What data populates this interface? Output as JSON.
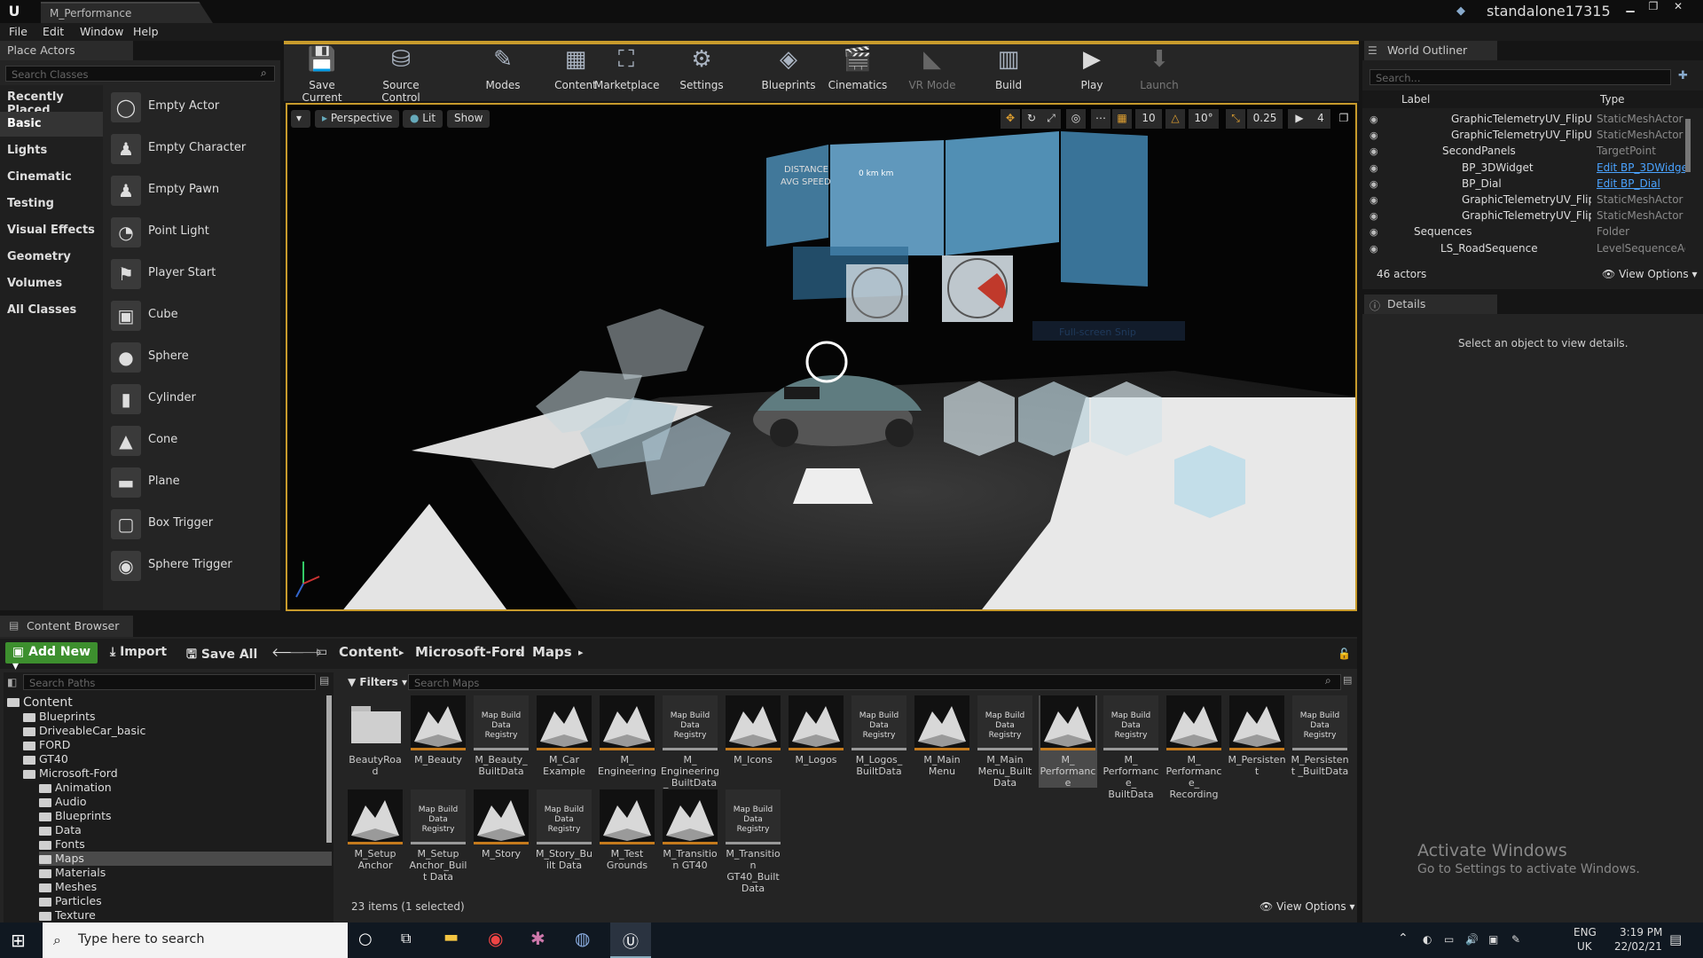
{
  "window": {
    "tab_title": "M_Performance",
    "project": "standalone17315"
  },
  "menu": [
    "File",
    "Edit",
    "Window",
    "Help"
  ],
  "place_actors": {
    "tab": "Place Actors",
    "search_placeholder": "Search Classes",
    "categories": [
      "Recently Placed",
      "Basic",
      "Lights",
      "Cinematic",
      "Testing",
      "Visual Effects",
      "Geometry",
      "Volumes",
      "All Classes"
    ],
    "selected_category": "Basic",
    "actors": [
      "Empty Actor",
      "Empty Character",
      "Empty Pawn",
      "Point Light",
      "Player Start",
      "Cube",
      "Sphere",
      "Cylinder",
      "Cone",
      "Plane",
      "Box Trigger",
      "Sphere Trigger"
    ]
  },
  "toolbar": {
    "buttons": [
      "Save Current",
      "Source Control",
      "Modes",
      "Content",
      "Marketplace",
      "Settings",
      "Blueprints",
      "Cinematics",
      "VR Mode",
      "Build",
      "Play",
      "Launch"
    ]
  },
  "viewport": {
    "perspective": "Perspective",
    "lit": "Lit",
    "show": "Show",
    "grid_snap": "10",
    "rot_snap": "10°",
    "scale_snap": "0.25",
    "cam_speed": "4",
    "scene_text": {
      "distance": "DISTANCE",
      "avg_speed": "AVG SPEED",
      "panel_value": "0 km km",
      "fullscreen": "Full-screen Snip"
    }
  },
  "world_outliner": {
    "tab": "World Outliner",
    "search_placeholder": "Search...",
    "col_label": "Label",
    "col_type": "Type",
    "rows": [
      {
        "label": "GraphicTelemetryUV_FlipUV_T",
        "type": "StaticMeshActor",
        "link": false
      },
      {
        "label": "GraphicTelemetryUV_FlipUV_T",
        "type": "StaticMeshActor",
        "link": false
      },
      {
        "label": "SecondPanels",
        "type": "TargetPoint",
        "link": false
      },
      {
        "label": "BP_3DWidget",
        "type": "Edit BP_3DWidge",
        "link": true
      },
      {
        "label": "BP_Dial",
        "type": "Edit BP_Dial",
        "link": true
      },
      {
        "label": "GraphicTelemetryUV_FlipUV",
        "type": "StaticMeshActor",
        "link": false
      },
      {
        "label": "GraphicTelemetryUV_FlipUV",
        "type": "StaticMeshActor",
        "link": false
      },
      {
        "label": "Sequences",
        "type": "Folder",
        "link": false
      },
      {
        "label": "LS_RoadSequence",
        "type": "LevelSequenceAct",
        "link": false
      }
    ],
    "actor_count": "46 actors",
    "view_options": "View Options"
  },
  "details": {
    "tab": "Details",
    "message": "Select an object to view details."
  },
  "content_browser": {
    "tab": "Content Browser",
    "add_new": "Add New",
    "import": "Import",
    "save_all": "Save All",
    "breadcrumbs": [
      "Content",
      "Microsoft-Ford",
      "Maps"
    ],
    "search_paths_placeholder": "Search Paths",
    "filters": "Filters",
    "search_maps_placeholder": "Search Maps",
    "tree": [
      {
        "label": "Content",
        "depth": 0
      },
      {
        "label": "Blueprints",
        "depth": 1
      },
      {
        "label": "DriveableCar_basic",
        "depth": 1
      },
      {
        "label": "FORD",
        "depth": 1
      },
      {
        "label": "GT40",
        "depth": 1
      },
      {
        "label": "Microsoft-Ford",
        "depth": 1
      },
      {
        "label": "Animation",
        "depth": 2
      },
      {
        "label": "Audio",
        "depth": 2
      },
      {
        "label": "Blueprints",
        "depth": 2
      },
      {
        "label": "Data",
        "depth": 2
      },
      {
        "label": "Fonts",
        "depth": 2
      },
      {
        "label": "Maps",
        "depth": 2
      },
      {
        "label": "Materials",
        "depth": 2
      },
      {
        "label": "Meshes",
        "depth": 2
      },
      {
        "label": "Particles",
        "depth": 2
      },
      {
        "label": "Texture",
        "depth": 2
      }
    ],
    "registry_text": "Map Build Data Registry",
    "assets": [
      {
        "label": "BeautyRoad",
        "kind": "folder"
      },
      {
        "label": "M_Beauty",
        "kind": "map"
      },
      {
        "label": "M_Beauty_ BuiltData",
        "kind": "reg"
      },
      {
        "label": "M_Car Example",
        "kind": "map"
      },
      {
        "label": "M_ Engineering",
        "kind": "map"
      },
      {
        "label": "M_ Engineering_ BuiltData",
        "kind": "reg"
      },
      {
        "label": "M_Icons",
        "kind": "map"
      },
      {
        "label": "M_Logos",
        "kind": "map"
      },
      {
        "label": "M_Logos_ BuiltData",
        "kind": "reg"
      },
      {
        "label": "M_Main Menu",
        "kind": "map"
      },
      {
        "label": "M_Main Menu_Built Data",
        "kind": "reg"
      },
      {
        "label": "M_ Performance",
        "kind": "map",
        "selected": true
      },
      {
        "label": "M_ Performance_ BuiltData",
        "kind": "reg"
      },
      {
        "label": "M_ Performance_ Recording",
        "kind": "map"
      },
      {
        "label": "M_Persistent",
        "kind": "map"
      },
      {
        "label": "M_Persistent _BuiltData",
        "kind": "reg"
      },
      {
        "label": "M_Setup Anchor",
        "kind": "map"
      },
      {
        "label": "M_Setup Anchor_Built Data",
        "kind": "reg"
      },
      {
        "label": "M_Story",
        "kind": "map"
      },
      {
        "label": "M_Story_Built Data",
        "kind": "reg"
      },
      {
        "label": "M_Test Grounds",
        "kind": "map"
      },
      {
        "label": "M_Transition GT40",
        "kind": "map"
      },
      {
        "label": "M_Transition GT40_Built Data",
        "kind": "reg"
      }
    ],
    "status": "23 items (1 selected)",
    "view_options": "View Options"
  },
  "watermark": {
    "line1": "Activate Windows",
    "line2": "Go to Settings to activate Windows."
  },
  "taskbar": {
    "search_placeholder": "Type here to search",
    "lang": "ENG",
    "region": "UK",
    "time": "3:19 PM",
    "date": "22/02/21"
  },
  "colors": {
    "accent": "#c89b2c",
    "green": "#3d8f2e",
    "link": "#4aa3ff"
  }
}
